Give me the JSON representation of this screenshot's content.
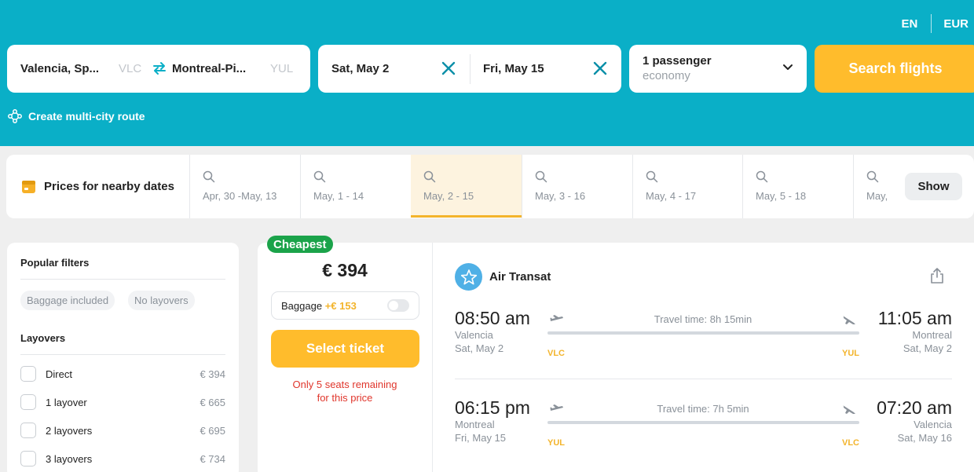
{
  "top_bar": {
    "language": "EN",
    "currency": "EUR"
  },
  "search": {
    "origin_city": "Valencia, Sp...",
    "origin_code": "VLC",
    "destination_city": "Montreal-Pi...",
    "destination_code": "YUL",
    "depart_date": "Sat, May 2",
    "return_date": "Fri, May 15",
    "passengers": "1 passenger",
    "cabin_class": "economy",
    "search_button": "Search flights",
    "multi_city_link": "Create multi-city route"
  },
  "nearby_dates": {
    "title": "Prices for nearby dates",
    "items": [
      {
        "label": "Apr, 30 -May, 13"
      },
      {
        "label": "May, 1 - 14"
      },
      {
        "label": "May, 2 - 15"
      },
      {
        "label": "May, 3 - 16"
      },
      {
        "label": "May, 4 - 17"
      },
      {
        "label": "May, 5 - 18"
      },
      {
        "label": "May,"
      }
    ],
    "selected_index": 2,
    "show_button": "Show"
  },
  "filters": {
    "popular_title": "Popular filters",
    "chips": [
      "Baggage included",
      "No layovers"
    ],
    "layovers_title": "Layovers",
    "layover_options": [
      {
        "label": "Direct",
        "price": "€ 394"
      },
      {
        "label": "1 layover",
        "price": "€ 665"
      },
      {
        "label": "2 layovers",
        "price": "€ 695"
      },
      {
        "label": "3 layovers",
        "price": "€ 734"
      }
    ]
  },
  "ticket": {
    "badge": "Cheapest",
    "price": "€ 394",
    "baggage_label": "Baggage",
    "baggage_price": "+€ 153",
    "select_button": "Select ticket",
    "seats_line1": "Only 5 seats remaining",
    "seats_line2": "for this price",
    "airline": "Air Transat",
    "legs": [
      {
        "depart_time": "08:50 am",
        "depart_city": "Valencia",
        "depart_date": "Sat, May 2",
        "travel_time": "Travel time: 8h 15min",
        "arrive_time": "11:05 am",
        "arrive_city": "Montreal",
        "arrive_date": "Sat, May 2",
        "from_code": "VLC",
        "to_code": "YUL"
      },
      {
        "depart_time": "06:15 pm",
        "depart_city": "Montreal",
        "depart_date": "Fri, May 15",
        "travel_time": "Travel time: 7h 5min",
        "arrive_time": "07:20 am",
        "arrive_city": "Valencia",
        "arrive_date": "Sat, May 16",
        "from_code": "YUL",
        "to_code": "VLC"
      }
    ]
  },
  "colors": {
    "header_bg": "#0aafc7",
    "accent_yellow": "#ffbc2c",
    "badge_green": "#1ba34a",
    "warning_red": "#e0362c",
    "airport_code": "#f3b42c"
  }
}
